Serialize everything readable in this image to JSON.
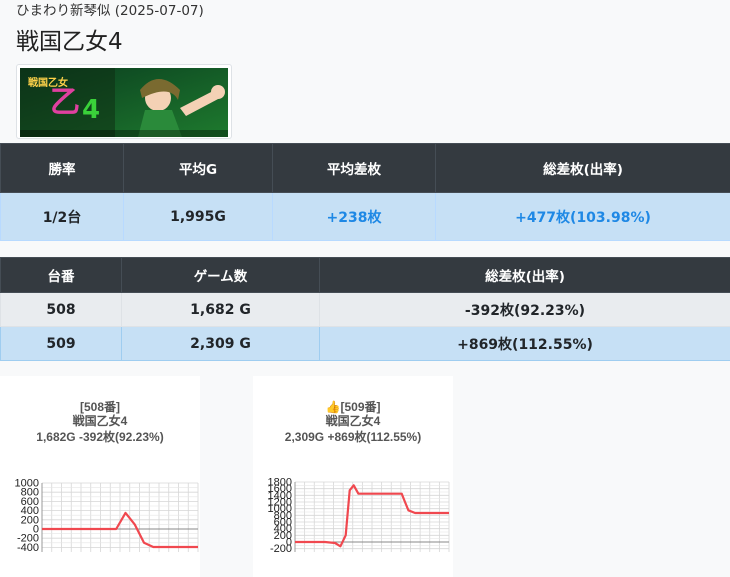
{
  "header": {
    "subtitle": "ひまわり新琴似 (2025-07-07)",
    "title": "戦国乙女4"
  },
  "banner": {
    "label": "戦国乙女4 banner image"
  },
  "summary": {
    "headers": [
      "勝率",
      "平均G",
      "平均差枚",
      "総差枚(出率)"
    ],
    "row": {
      "win_rate": "1/2台",
      "avg_games": "1,995G",
      "avg_diff": "+238枚",
      "total_diff": "+477枚(103.98%)"
    }
  },
  "machines": {
    "headers": [
      "台番",
      "ゲーム数",
      "総差枚(出率)"
    ],
    "rows": [
      {
        "no": "508",
        "games": "1,682 G",
        "diff": "-392枚(92.23%)"
      },
      {
        "no": "509",
        "games": "2,309 G",
        "diff": "+869枚(112.55%)"
      }
    ]
  },
  "charts": [
    {
      "label": "[508番]",
      "name": "戦国乙女4",
      "summary": "1,682G -392枚(92.23%)",
      "chart_data": {
        "type": "line",
        "yticks": [
          1000,
          800,
          600,
          400,
          200,
          0,
          -200,
          -400
        ],
        "ylim": [
          -500,
          1000
        ],
        "x": [
          0,
          100,
          200,
          300,
          400,
          500,
          600,
          700,
          800,
          900,
          1000,
          1100,
          1200,
          1300,
          1400,
          1500,
          1600,
          1682
        ],
        "y": [
          0,
          0,
          0,
          0,
          0,
          0,
          0,
          0,
          0,
          350,
          100,
          -300,
          -392,
          -392,
          -392,
          -392,
          -392,
          -392
        ],
        "grid": true,
        "color": "#f0484f"
      }
    },
    {
      "label": "[509番]",
      "name": "戦国乙女4",
      "summary": "2,309G +869枚(112.55%)",
      "icon": "thumbs-up-icon",
      "chart_data": {
        "type": "line",
        "yticks": [
          1800,
          1600,
          1400,
          1200,
          1000,
          800,
          600,
          400,
          200,
          0,
          -200
        ],
        "ylim": [
          -300,
          1800
        ],
        "x": [
          0,
          150,
          300,
          450,
          600,
          680,
          760,
          820,
          880,
          950,
          1000,
          1100,
          1200,
          1300,
          1400,
          1500,
          1600,
          1650,
          1700,
          1800,
          1900,
          2000,
          2100,
          2200,
          2309
        ],
        "y": [
          0,
          0,
          0,
          0,
          -30,
          -130,
          200,
          1550,
          1700,
          1450,
          1450,
          1450,
          1450,
          1450,
          1450,
          1450,
          1450,
          1200,
          950,
          869,
          869,
          869,
          869,
          869,
          869
        ],
        "grid": true,
        "color": "#f0484f"
      }
    }
  ]
}
